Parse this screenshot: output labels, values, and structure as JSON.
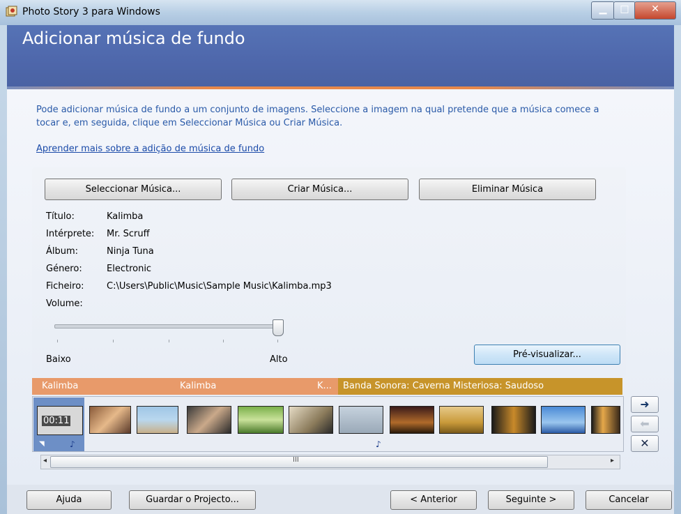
{
  "window": {
    "title": "Photo Story 3 para Windows",
    "minimize_icon": "minimize-icon",
    "maximize_icon": "maximize-icon",
    "close_icon": "close-icon"
  },
  "header": {
    "title": "Adicionar música de fundo"
  },
  "intro": {
    "text": "Pode adicionar música de fundo a um conjunto de imagens. Seleccione a imagem na qual pretende que a música comece a tocar e, em seguida, clique em Seleccionar Música ou Criar Música.",
    "link": "Aprender mais sobre a adição de música de fundo"
  },
  "music_buttons": {
    "select": "Seleccionar Música...",
    "create": "Criar Música...",
    "remove": "Eliminar Música"
  },
  "details": {
    "title_label": "Título:",
    "title_value": "Kalimba",
    "artist_label": "Intérprete:",
    "artist_value": "Mr. Scruff",
    "album_label": "Álbum:",
    "album_value": "Ninja Tuna",
    "genre_label": "Género:",
    "genre_value": "Electronic",
    "file_label": "Ficheiro:",
    "file_value": "C:\\Users\\Public\\Music\\Sample Music\\Kalimba.mp3",
    "volume_label": "Volume:"
  },
  "volume": {
    "low_label": "Baixo",
    "high_label": "Alto",
    "level": 1.0
  },
  "preview_button": "Pré-visualizar...",
  "timeline": {
    "orange_labels": [
      "Kalimba",
      "Kalimba",
      "K..."
    ],
    "gold_label": "Banda Sonora: Caverna Misteriosa: Saudoso",
    "selected_time": "00:11",
    "scroll_mid": "III"
  },
  "nav": {
    "right_arrow_icon": "arrow-right-icon",
    "left_arrow_icon": "arrow-left-icon",
    "delete_icon": "delete-x-icon"
  },
  "footer": {
    "help": "Ajuda",
    "save": "Guardar o Projecto...",
    "back": "< Anterior",
    "next": "Seguinte >",
    "cancel": "Cancelar"
  },
  "colors": {
    "header_blue": "#4e67ab",
    "accent_orange": "#e8884a",
    "music_orange": "#e89a6a",
    "music_gold": "#c7942a",
    "link_blue": "#1a4aa8"
  }
}
